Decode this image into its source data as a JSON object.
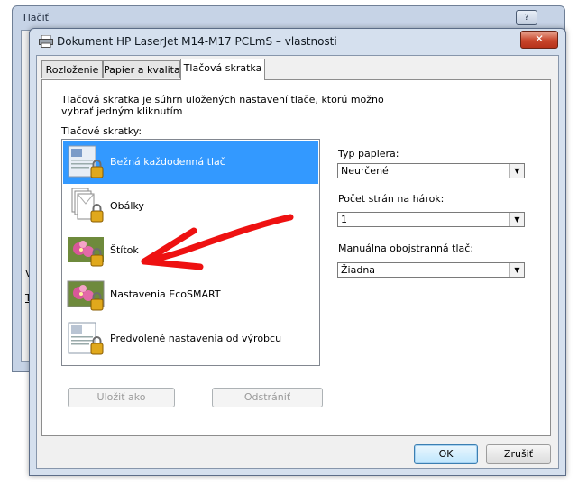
{
  "background_window": {
    "title": "Tlačiť",
    "help_label": "?",
    "fragments": [
      "V",
      "T"
    ]
  },
  "window": {
    "title": "Dokument HP LaserJet M14-M17 PCLmS – vlastnosti",
    "close_label": "✕"
  },
  "tabs": [
    {
      "label": "Rozloženie",
      "active": false
    },
    {
      "label": "Papier a kvalita",
      "active": false
    },
    {
      "label": "Tlačová skratka",
      "active": true
    }
  ],
  "panel": {
    "description": "Tlačová skratka je súhrn uložených nastavení tlače, ktorú možno vybrať jedným kliknutím",
    "shortcuts_label": "Tlačové skratky:",
    "shortcuts": [
      {
        "label": "Bežná každodenná tlač",
        "icon": "document-lock-icon",
        "selected": true
      },
      {
        "label": "Obálky",
        "icon": "envelope-lock-icon",
        "selected": false
      },
      {
        "label": "Štítok",
        "icon": "photo-lock-icon",
        "selected": false
      },
      {
        "label": "Nastavenia EcoSMART",
        "icon": "photo-lock-icon",
        "selected": false
      },
      {
        "label": "Predvolené nastavenia od výrobcu",
        "icon": "document-lock-icon",
        "selected": false
      }
    ],
    "paper_type": {
      "label": "Typ papiera:",
      "value": "Neurčené"
    },
    "pages_per_sheet": {
      "label": "Počet strán na hárok:",
      "value": "1"
    },
    "duplex": {
      "label": "Manuálna obojstranná tlač:",
      "value": "Žiadna"
    },
    "save_as_label": "Uložiť ako",
    "delete_label": "Odstrániť"
  },
  "footer": {
    "ok_label": "OK",
    "cancel_label": "Zrušiť"
  },
  "colors": {
    "selection": "#3399ff",
    "annotation_arrow": "#ee1111",
    "close_button": "#c8452a"
  }
}
